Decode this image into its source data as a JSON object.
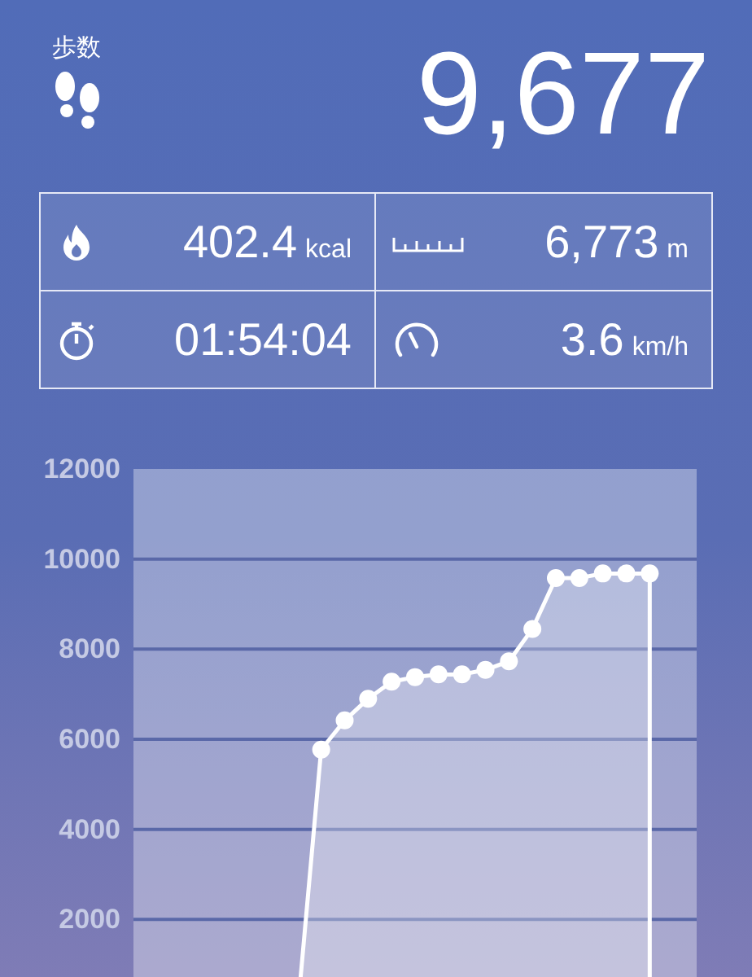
{
  "steps": {
    "label": "歩数",
    "value": "9,677"
  },
  "stats": [
    {
      "kind": "calories",
      "value": "402.4",
      "unit": "kcal"
    },
    {
      "kind": "distance",
      "value": "6,773",
      "unit": "m"
    },
    {
      "kind": "time",
      "value": "01:54:04"
    },
    {
      "kind": "speed",
      "value": "3.6",
      "unit": "km/h"
    }
  ],
  "chart": {
    "chart_data": {
      "type": "area",
      "ylim": [
        0,
        12000
      ],
      "yticks": [
        2000,
        4000,
        6000,
        8000,
        10000,
        12000
      ],
      "grid": true,
      "categories": [
        null,
        null,
        null,
        null,
        null,
        null,
        null,
        null,
        null,
        null,
        null,
        null,
        null,
        null,
        null,
        null,
        null,
        null,
        null,
        null,
        null,
        null,
        null,
        null
      ],
      "series": [
        {
          "color": "#ffffff",
          "values": [
            null,
            null,
            null,
            null,
            null,
            null,
            null,
            0,
            5770,
            6420,
            6900,
            7280,
            7380,
            7440,
            7440,
            7540,
            7730,
            8450,
            9580,
            9580,
            9680,
            9680,
            9680,
            null
          ]
        }
      ]
    }
  }
}
